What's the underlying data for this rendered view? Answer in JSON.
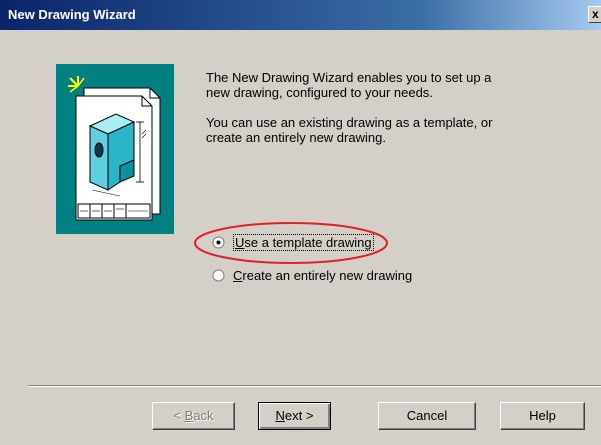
{
  "window": {
    "title": "New Drawing Wizard",
    "close_glyph": "x"
  },
  "intro": {
    "paragraph1": "The New Drawing Wizard enables you to set up a new drawing, configured to your needs.",
    "paragraph2": "You can use an existing drawing as a template, or create an entirely new drawing."
  },
  "options": [
    {
      "accel": "U",
      "rest": "se a template drawing",
      "selected": true
    },
    {
      "accel": "C",
      "rest": "reate an entirely new drawing",
      "selected": false
    }
  ],
  "buttons": {
    "back_prefix": "< ",
    "back_accel": "B",
    "back_rest": "ack",
    "next_accel": "N",
    "next_rest": "ext >",
    "cancel": "Cancel",
    "help": "Help"
  },
  "colors": {
    "title_bar": "#0a246a",
    "dialog_bg": "#d4d0c8",
    "wizard_art_bg": "#008080",
    "highlight_ellipse": "#e0202a"
  },
  "icons": [
    "close-icon",
    "wizard-drawing-icon",
    "sparkle-icon",
    "radio-selected-icon",
    "radio-unselected-icon"
  ]
}
